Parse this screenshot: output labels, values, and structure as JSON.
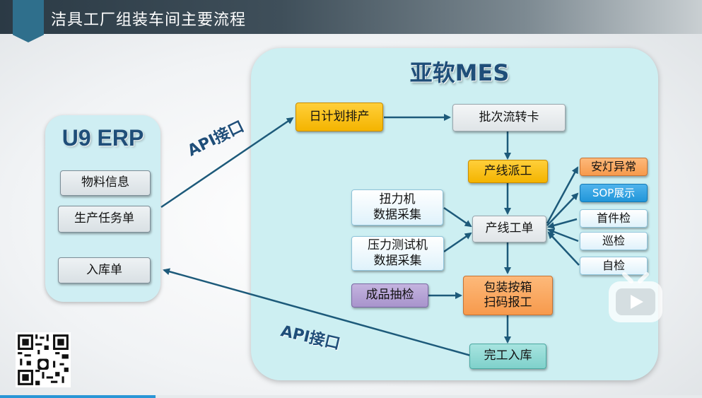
{
  "header": {
    "title": "洁具工厂组装车间主要流程"
  },
  "erp": {
    "title": "U9 ERP",
    "items": [
      "物料信息",
      "生产任务单",
      "入库单"
    ]
  },
  "mes": {
    "title": "亚软MES",
    "nodes": {
      "daily_plan": "日计划排产",
      "batch_card": "批次流转卡",
      "line_dispatch": "产线派工",
      "line_work_order": "产线工单",
      "torque_machine": [
        "扭力机",
        "数据采集"
      ],
      "pressure_tester": [
        "压力测试机",
        "数据采集"
      ],
      "finished_sampling": "成品抽检",
      "pack_scan": [
        "包装按箱",
        "扫码报工"
      ],
      "completion_storage": "完工入库",
      "andon": "安灯异常",
      "sop_display": "SOP展示",
      "first_inspection": "首件检",
      "patrol_inspection": "巡检",
      "self_inspection": "自检"
    }
  },
  "api_labels": {
    "top": "API接口",
    "bottom": "API接口"
  },
  "colors": {
    "panel_bg": "#cdeff2",
    "title_blue": "#1f4e79",
    "arrow": "#1d5a7a",
    "orange": "#f4b400",
    "peach": "#f79a4c",
    "blue": "#2196d9",
    "purple": "#a894cc",
    "teal": "#7fd1cb"
  }
}
